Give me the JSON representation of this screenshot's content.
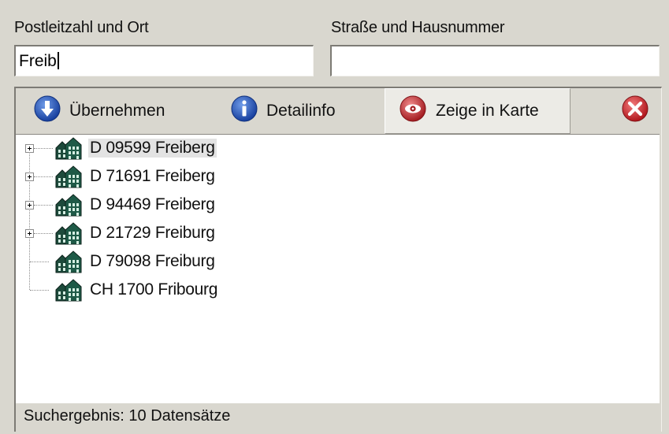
{
  "form": {
    "plz_label": "Postleitzahl und Ort",
    "plz_value": "Freib",
    "street_label": "Straße und Hausnummer",
    "street_value": ""
  },
  "toolbar": {
    "uebernehmen": "Übernehmen",
    "detailinfo": "Detailinfo",
    "zeige_in_karte": "Zeige in Karte",
    "close_icon": "close-icon"
  },
  "results": [
    {
      "label": "D 09599 Freiberg",
      "expandable": true,
      "selected": true
    },
    {
      "label": "D 71691 Freiberg",
      "expandable": true,
      "selected": false
    },
    {
      "label": "D 94469 Freiberg",
      "expandable": true,
      "selected": false
    },
    {
      "label": "D 21729 Freiburg",
      "expandable": true,
      "selected": false
    },
    {
      "label": "D 79098 Freiburg",
      "expandable": false,
      "selected": false
    },
    {
      "label": "CH 1700 Fribourg",
      "expandable": false,
      "selected": false
    }
  ],
  "status": {
    "text": "Suchergebnis: 10 Datensätze"
  },
  "colors": {
    "blue_icon": "#1f4fb5",
    "red_icon": "#c9262b",
    "highlight": "#e3e3e3"
  }
}
